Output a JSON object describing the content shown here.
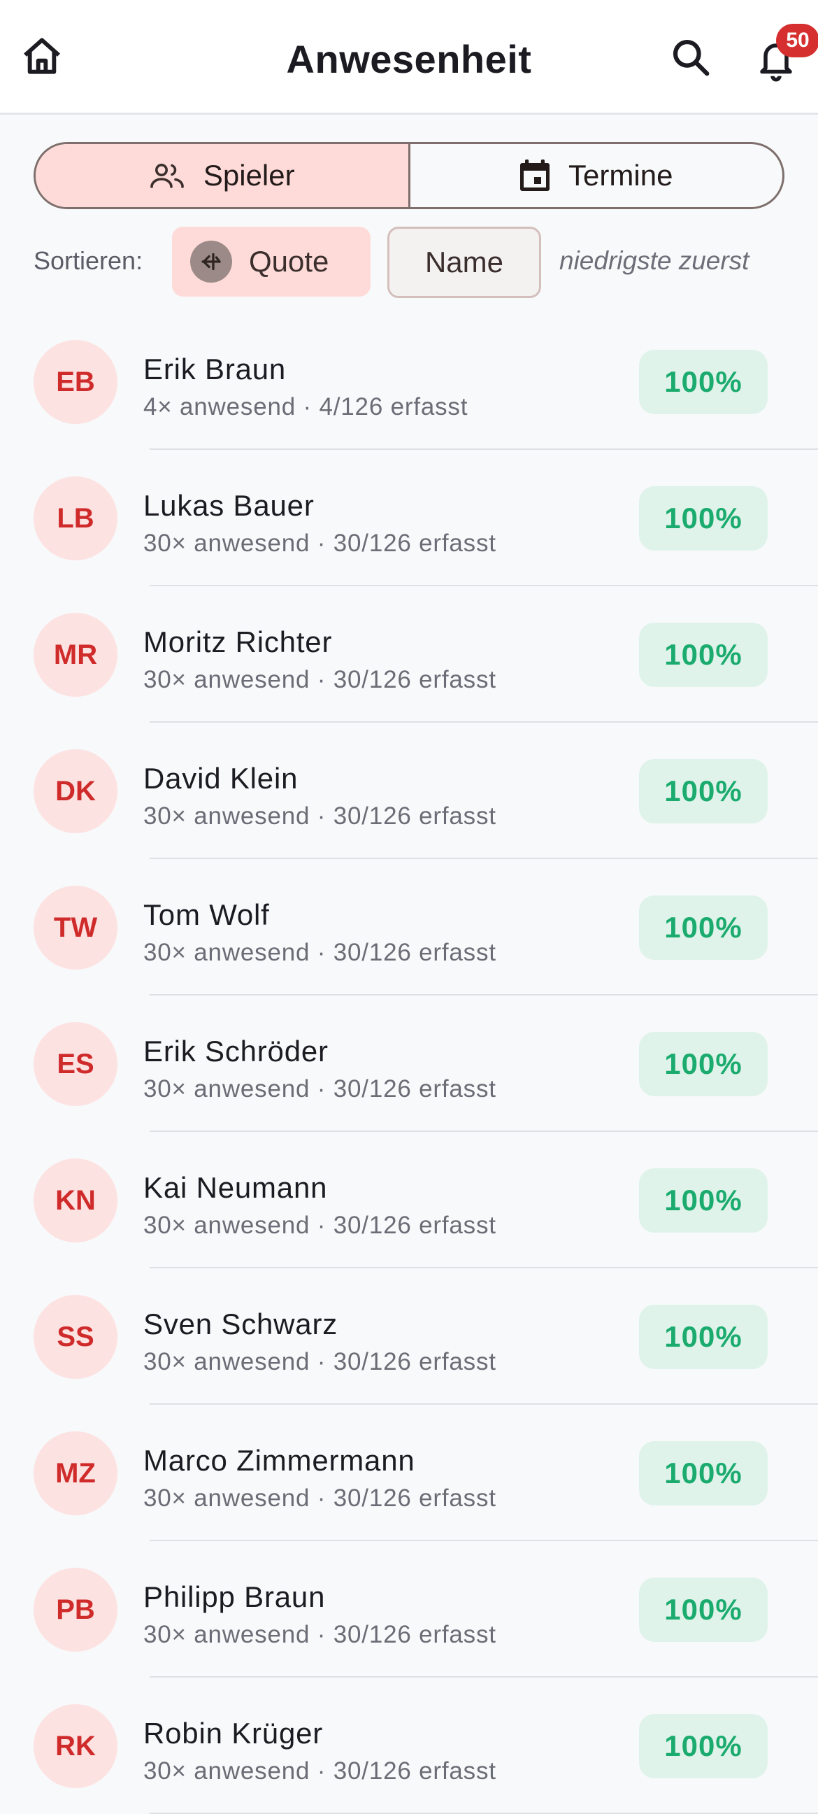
{
  "header": {
    "title": "Anwesenheit",
    "home_icon": "home-icon",
    "search_icon": "search-icon",
    "bell_icon": "bell-icon",
    "notification_count": "50"
  },
  "tabs": [
    {
      "label": "Spieler",
      "icon": "people-icon",
      "active": true
    },
    {
      "label": "Termine",
      "icon": "calendar-icon",
      "active": false
    }
  ],
  "sort": {
    "label": "Sortieren:",
    "options": [
      {
        "label": "Quote",
        "selected": true
      },
      {
        "label": "Name",
        "selected": false
      }
    ],
    "hint": "niedrigste zuerst"
  },
  "players": [
    {
      "initials": "EB",
      "name": "Erik Braun",
      "summary": "4× anwesend · 4/126 erfasst",
      "rate": "100%"
    },
    {
      "initials": "LB",
      "name": "Lukas Bauer",
      "summary": "30× anwesend · 30/126 erfasst",
      "rate": "100%"
    },
    {
      "initials": "MR",
      "name": "Moritz Richter",
      "summary": "30× anwesend · 30/126 erfasst",
      "rate": "100%"
    },
    {
      "initials": "DK",
      "name": "David Klein",
      "summary": "30× anwesend · 30/126 erfasst",
      "rate": "100%"
    },
    {
      "initials": "TW",
      "name": "Tom Wolf",
      "summary": "30× anwesend · 30/126 erfasst",
      "rate": "100%"
    },
    {
      "initials": "ES",
      "name": "Erik Schröder",
      "summary": "30× anwesend · 30/126 erfasst",
      "rate": "100%"
    },
    {
      "initials": "KN",
      "name": "Kai Neumann",
      "summary": "30× anwesend · 30/126 erfasst",
      "rate": "100%"
    },
    {
      "initials": "SS",
      "name": "Sven Schwarz",
      "summary": "30× anwesend · 30/126 erfasst",
      "rate": "100%"
    },
    {
      "initials": "MZ",
      "name": "Marco Zimmermann",
      "summary": "30× anwesend · 30/126 erfasst",
      "rate": "100%"
    },
    {
      "initials": "PB",
      "name": "Philipp Braun",
      "summary": "30× anwesend · 30/126 erfasst",
      "rate": "100%"
    },
    {
      "initials": "RK",
      "name": "Robin Krüger",
      "summary": "30× anwesend · 30/126 erfasst",
      "rate": "100%"
    }
  ],
  "colors": {
    "accent_light": "#fedbd8",
    "avatar_bg": "#fde2e2",
    "avatar_text": "#d02b2b",
    "rate_bg": "#dff3ea",
    "rate_text": "#1bab6e",
    "badge": "#d62f2f"
  }
}
